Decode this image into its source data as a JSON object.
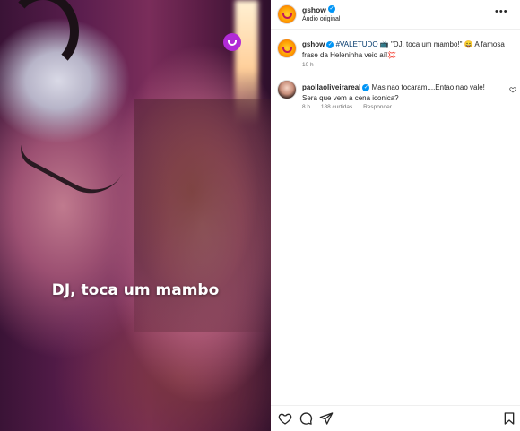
{
  "media": {
    "caption_overlay": "DJ, toca um mambo"
  },
  "header": {
    "username": "gshow",
    "audio": "Áudio original",
    "more_icon": "more-dots-icon"
  },
  "post": {
    "username": "gshow",
    "hashtag": "#VALETUDO",
    "text_prefix": " 📺 \"DJ, toca um mambo!\" 😄 A famosa frase da Heleninha veio aí!💢",
    "time": "10 h"
  },
  "comment": {
    "username": "paollaoliveirareal",
    "text": " Mas nao tocaram....Entao nao vale! Sera que vem a cena iconica?",
    "time": "8 h",
    "likes": "188 curtidas",
    "reply": "Responder"
  },
  "actions": {
    "icons": [
      "heart-icon",
      "comment-icon",
      "share-icon",
      "bookmark-icon"
    ]
  },
  "colors": {
    "verified": "#0095f6",
    "hashtag": "#00376b",
    "badge": "#b12bd6"
  }
}
